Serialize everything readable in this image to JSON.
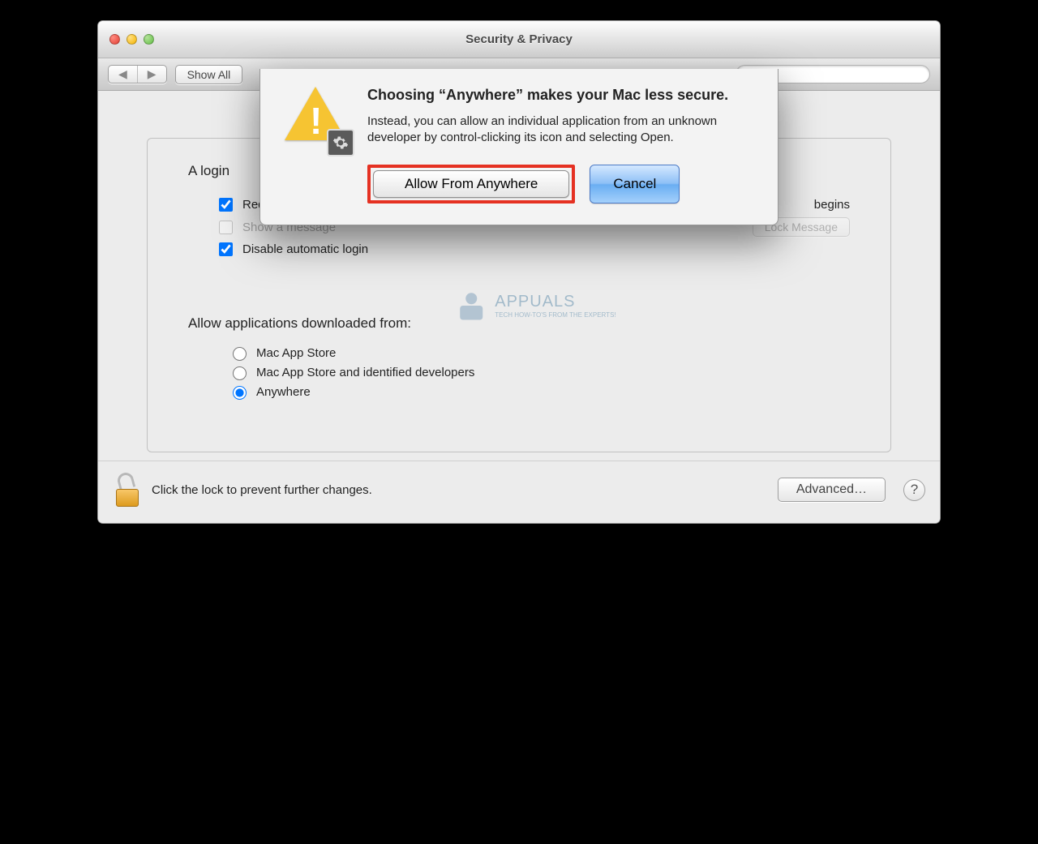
{
  "window": {
    "title": "Security & Privacy",
    "show_all": "Show All"
  },
  "search": {
    "placeholder": ""
  },
  "login_section": {
    "heading_start": "A login",
    "require_password": "Require password",
    "after_sleep_suffix": "begins",
    "show_message": "Show a message",
    "set_lock_message": "Lock Message",
    "disable_auto_login": "Disable automatic login"
  },
  "download_section": {
    "heading": "Allow applications downloaded from:",
    "mac_app_store": "Mac App Store",
    "mac_app_store_dev": "Mac App Store and identified developers",
    "anywhere": "Anywhere"
  },
  "footer": {
    "lock_text": "Click the lock to prevent further changes.",
    "advanced": "Advanced…",
    "help": "?"
  },
  "sheet": {
    "heading": "Choosing “Anywhere” makes your Mac less secure.",
    "body": "Instead, you can allow an individual application from an unknown developer by control-clicking its icon and selecting Open.",
    "allow": "Allow From Anywhere",
    "cancel": "Cancel"
  },
  "watermark": {
    "name": "APPUALS",
    "tagline": "TECH HOW-TO'S FROM THE EXPERTS!"
  }
}
